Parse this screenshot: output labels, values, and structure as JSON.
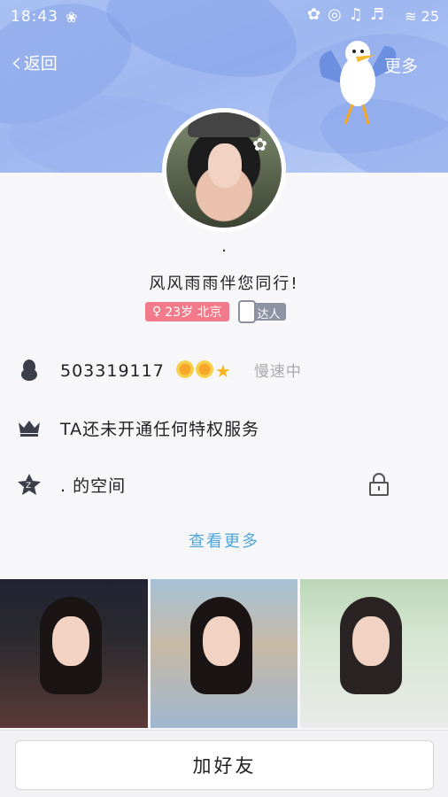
{
  "status_bar": {
    "time": "18:43",
    "battery": "25",
    "icons": [
      "paw-icon",
      "signal-icon",
      "music-icon",
      "wifi-icon"
    ]
  },
  "nav": {
    "back_label": "返回",
    "more_label": "更多"
  },
  "profile": {
    "name": ".",
    "signature": "风风雨雨伴您同行!",
    "age_location": "23岁 北京",
    "badge_label": "达人"
  },
  "info": {
    "qq_number": "503319117",
    "qq_status": "慢速中",
    "vip_text": "TA还未开通任何特权服务",
    "zone_text": ". 的空间"
  },
  "see_more_label": "查看更多",
  "photos": [
    "photo-1",
    "photo-2",
    "photo-3"
  ],
  "add_friend_label": "加好友",
  "colors": {
    "banner": "#a9c0f3",
    "age_tag": "#f17b8a",
    "link": "#4fa6d8",
    "badge": "#8e93a3"
  }
}
